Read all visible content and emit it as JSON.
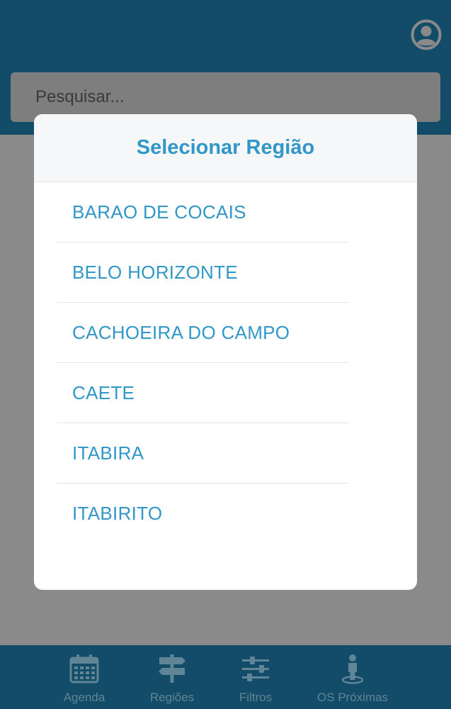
{
  "header": {
    "search": {
      "placeholder": "Pesquisar..."
    },
    "avatar_icon": "user-circle-icon"
  },
  "modal": {
    "title": "Selecionar Região",
    "regions": [
      {
        "label": "BARAO DE COCAIS"
      },
      {
        "label": "BELO HORIZONTE"
      },
      {
        "label": "CACHOEIRA DO CAMPO"
      },
      {
        "label": "CAETE"
      },
      {
        "label": "ITABIRA"
      },
      {
        "label": "ITABIRITO"
      }
    ]
  },
  "bottom_nav": {
    "items": [
      {
        "label": "Agenda",
        "icon": "calendar-icon"
      },
      {
        "label": "Regiões",
        "icon": "signpost-icon"
      },
      {
        "label": "Filtros",
        "icon": "sliders-icon"
      },
      {
        "label": "OS Próximas",
        "icon": "location-person-icon"
      }
    ]
  },
  "colors": {
    "primary": "#134c68",
    "accent": "#3197c8",
    "overlay": "#8a8a8a",
    "nav_icon": "#5f8596"
  }
}
